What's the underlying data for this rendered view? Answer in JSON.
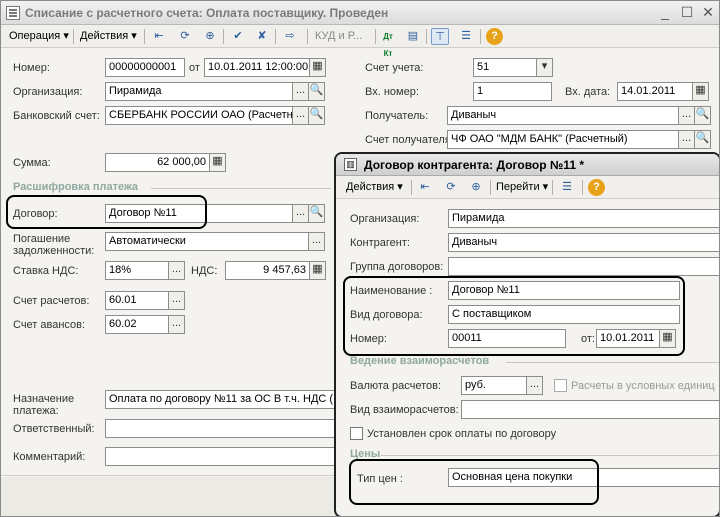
{
  "window": {
    "title": "Списание с расчетного счета: Оплата поставщику. Проведен",
    "minimize": "_",
    "maximize": "☐",
    "close": "✕"
  },
  "toolbar": {
    "operation_label": "Операция ▾",
    "actions_label": "Действия ▾",
    "kud_label": "КУД и Р...",
    "dt_kt_label": "Дт Кт"
  },
  "form": {
    "number_label": "Номер:",
    "number_value": "00000000001",
    "date_label": "от",
    "date_value": "10.01.2011 12:00:00",
    "org_label": "Организация:",
    "org_value": "Пирамида",
    "bank_label": "Банковский счет:",
    "bank_value": "СБЕРБАНК РОССИИ ОАО (Расчетны",
    "account_label": "Счет учета:",
    "account_value": "51",
    "in_number_label": "Вх. номер:",
    "in_number_value": "1",
    "in_date_label": "Вх. дата:",
    "in_date_value": "14.01.2011",
    "recipient_label": "Получатель:",
    "recipient_value": "Диваныч",
    "recipient_account_label": "Счет получателя:",
    "recipient_account_value": "ЧФ ОАО \"МДМ БАНК\" (Расчетный)",
    "sum_label": "Сумма:",
    "sum_value": "62 000,00",
    "payment_section": "Расшифровка платежа",
    "contract_label": "Договор:",
    "contract_value": "Договор №11",
    "repayment_label_1": "Погашение",
    "repayment_label_2": "задолженности:",
    "repayment_value": "Автоматически",
    "vat_rate_label": "Ставка НДС:",
    "vat_rate_value": "18%",
    "vat_label": "НДС:",
    "vat_value": "9 457,63",
    "settle_account_label": "Счет расчетов:",
    "settle_account_value": "60.01",
    "advance_account_label": "Счет авансов:",
    "advance_account_value": "60.02",
    "purpose_label_1": "Назначение",
    "purpose_label_2": "платежа:",
    "purpose_value": "Оплата по договору №11 за ОС В т.ч. НДС (",
    "responsible_label": "Ответственный:",
    "responsible_value": "",
    "comment_label": "Комментарий:",
    "comment_value": ""
  },
  "popup": {
    "title": "Договор контрагента: Договор №11 *",
    "actions_label": "Действия ▾",
    "goto_label": "Перейти ▾",
    "org_label": "Организация:",
    "org_value": "Пирамида",
    "counterparty_label": "Контрагент:",
    "counterparty_value": "Диваныч",
    "group_label": "Группа договоров:",
    "group_value": "",
    "name_label": "Наименование :",
    "name_value": "Договор №11",
    "type_label": "Вид договора:",
    "type_value": "С поставщиком",
    "number_label": "Номер:",
    "number_value": "00011",
    "date_label": "от:",
    "date_value": "10.01.2011",
    "mutual_section": "Ведение взаиморасчетов",
    "currency_label": "Валюта расчетов:",
    "currency_value": "руб.",
    "conditional_units_label": "Расчеты в условных единиц",
    "mutual_type_label": "Вид взаиморасчетов:",
    "mutual_type_value": "",
    "term_label": "Установлен срок оплаты по договору",
    "prices_section": "Цены",
    "price_type_label": "Тип цен :",
    "price_type_value": "Основная цена покупки"
  },
  "icons": {
    "ellipsis": "...",
    "search": "🔍",
    "calendar": "▦",
    "calc": "▦",
    "dropdown": "▾",
    "help": "?"
  }
}
